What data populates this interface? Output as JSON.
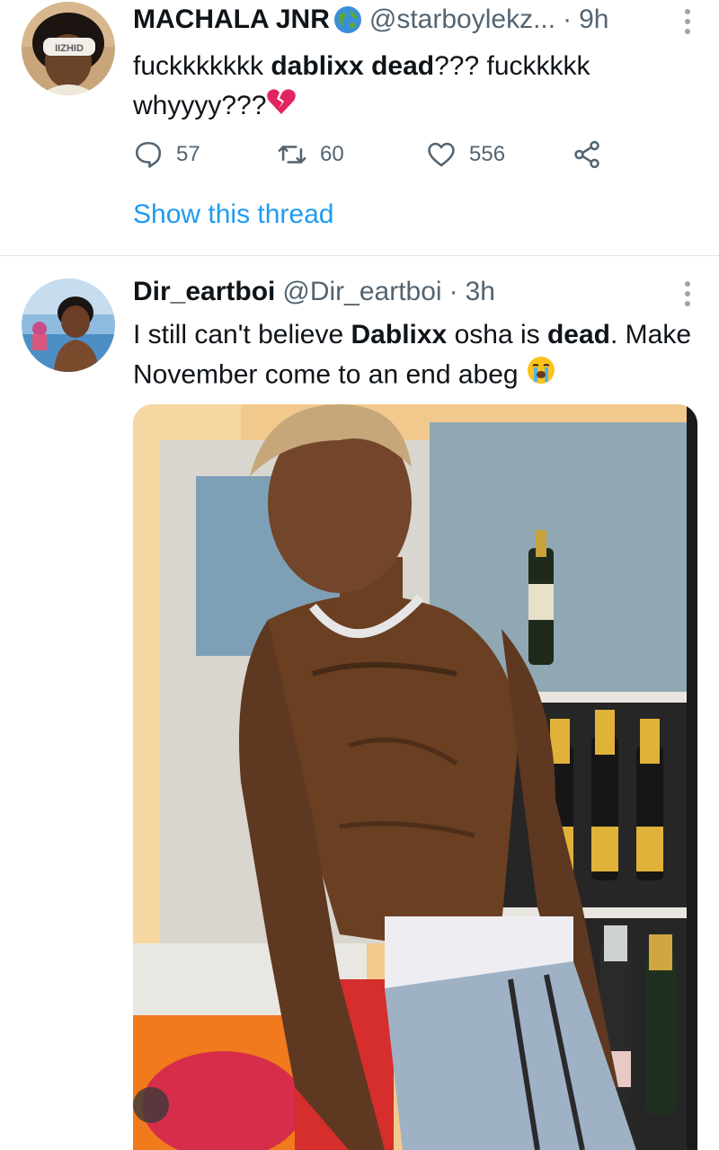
{
  "tweets": [
    {
      "display_name": "MACHALA JNR",
      "handle": "@starboylekz...",
      "separator": "·",
      "time": "9h",
      "text": {
        "p1": "fuckkkkkkk ",
        "b1": "dablixx dead",
        "p2": "??? fuckkkkk whyyyy???"
      },
      "emoji": "broken-heart",
      "verified_icon": "globe-earth-icon",
      "actions": {
        "replies": "57",
        "retweets": "60",
        "likes": "556"
      },
      "show_thread": "Show this thread"
    },
    {
      "display_name": "Dir_eartboi",
      "handle": "@Dir_eartboi",
      "separator": "·",
      "time": "3h",
      "text": {
        "p1": "I still can't believe ",
        "b1": "Dablixx",
        "p2": " osha is ",
        "b2": "dead",
        "p3": ". Make November come to an end abeg "
      },
      "emoji": "loudly-crying-face"
    }
  ],
  "colors": {
    "accent": "#1d9bf0",
    "secondary_text": "#536471",
    "divider": "#e3e6e8"
  }
}
